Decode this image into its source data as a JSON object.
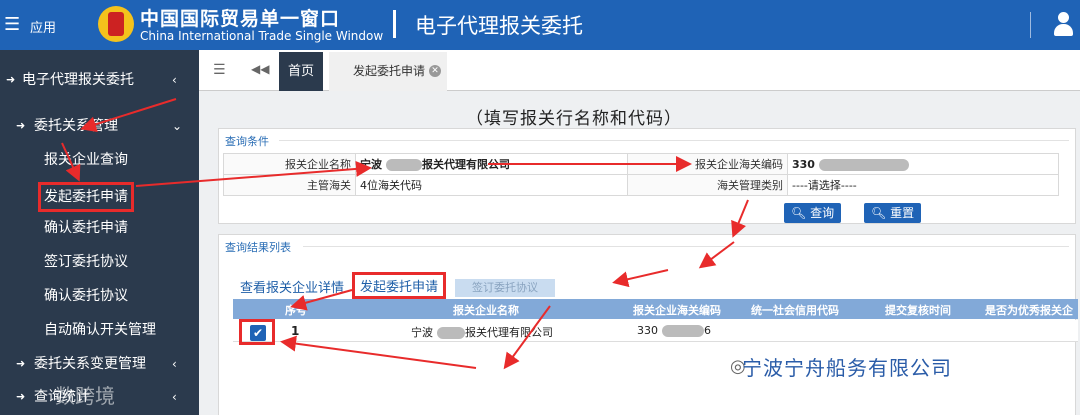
{
  "topbar": {
    "menu_label": "应用",
    "site_title": "中国国际贸易单一窗口",
    "site_subtitle": "China International Trade Single Window",
    "module_title": "电子代理报关委托"
  },
  "sidebar": {
    "module": "电子代理报关委托",
    "group1": "委托关系管理",
    "items": [
      "报关企业查询",
      "发起委托申请",
      "确认委托申请",
      "签订委托协议",
      "确认委托协议",
      "自动确认开关管理"
    ],
    "group2": "委托关系变更管理",
    "group3": "查询统计"
  },
  "tabs": {
    "home": "首页",
    "active": "发起委托申请"
  },
  "annotation": "（填写报关行名称和代码）",
  "query": {
    "title": "查询条件",
    "company_name_label": "报关企业名称",
    "company_name_value": "宁波",
    "company_name_suffix": "报关代理有限公司",
    "customs_code_label": "报关企业海关编码",
    "customs_code_value": "330",
    "main_customs_label": "主管海关",
    "main_customs_value": "4位海关代码",
    "category_label": "海关管理类别",
    "category_value": "----请选择----",
    "search_btn": "查询",
    "reset_btn": "重置"
  },
  "results": {
    "title": "查询结果列表",
    "actions": [
      "查看报关企业详情",
      "发起委托申请",
      "签订委托协议"
    ],
    "columns": [
      "序号",
      "报关企业名称",
      "报关企业海关编码",
      "统一社会信用代码",
      "提交复核时间",
      "是否为优秀报关企"
    ],
    "rows": [
      {
        "index": "1",
        "name_prefix": "宁波",
        "name_suffix": "报关代理有限公司",
        "code_prefix": "330",
        "code_suffix": "6"
      }
    ]
  },
  "watermark_left": "数跨境",
  "watermark_right": "宁波宁舟船务有限公司",
  "colors": {
    "topbar": "#1f63b6",
    "sidebar": "#2b3a4d",
    "annotation_red": "#e82b2b"
  }
}
